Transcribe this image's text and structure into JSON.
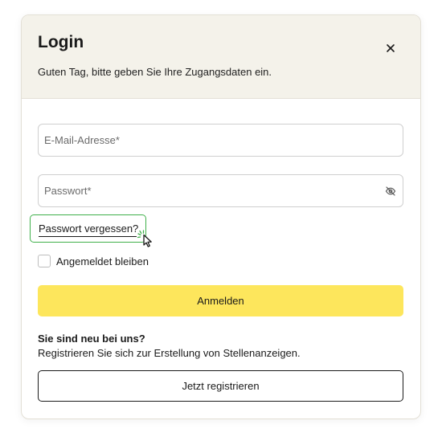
{
  "dialog": {
    "title": "Login",
    "subtitle": "Guten Tag, bitte geben Sie Ihre Zugangsdaten ein.",
    "close_icon": "close-icon"
  },
  "form": {
    "email": {
      "placeholder": "E-Mail-Adresse*",
      "value": ""
    },
    "password": {
      "placeholder": "Passwort*",
      "value": "",
      "toggle_icon": "eye-slash-icon"
    },
    "forgot_password_label": "Passwort vergessen?",
    "remember_label": "Angemeldet bleiben",
    "remember_checked": false,
    "submit_label": "Anmelden"
  },
  "register": {
    "heading": "Sie sind neu bei uns?",
    "text": "Registrieren Sie sich zur Erstellung von Stellenanzeigen.",
    "button_label": "Jetzt registrieren"
  },
  "colors": {
    "header_bg": "#f4f2ea",
    "primary_button": "#fde65c",
    "focus_outline": "#3fb04a",
    "text": "#1a1a1a"
  }
}
